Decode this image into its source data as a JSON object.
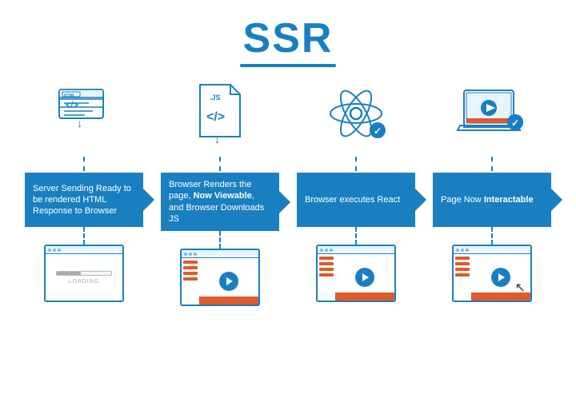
{
  "title": "SSR",
  "columns": [
    {
      "id": "col1",
      "box_text": "Server Sending Ready to be rendered HTML Response to Browser",
      "box_bold": "",
      "browser_type": "loading"
    },
    {
      "id": "col2",
      "box_text": "Browser Renders the page, ",
      "box_bold_part": "Now Viewable",
      "box_text2": ", and Browser Downloads JS",
      "browser_type": "content"
    },
    {
      "id": "col3",
      "box_text": "Browser executes React",
      "box_bold": "",
      "browser_type": "content"
    },
    {
      "id": "col4",
      "box_text": "Page Now ",
      "box_bold_part": "Interactable",
      "browser_type": "content_cursor"
    }
  ],
  "loading_label": "LOADING"
}
